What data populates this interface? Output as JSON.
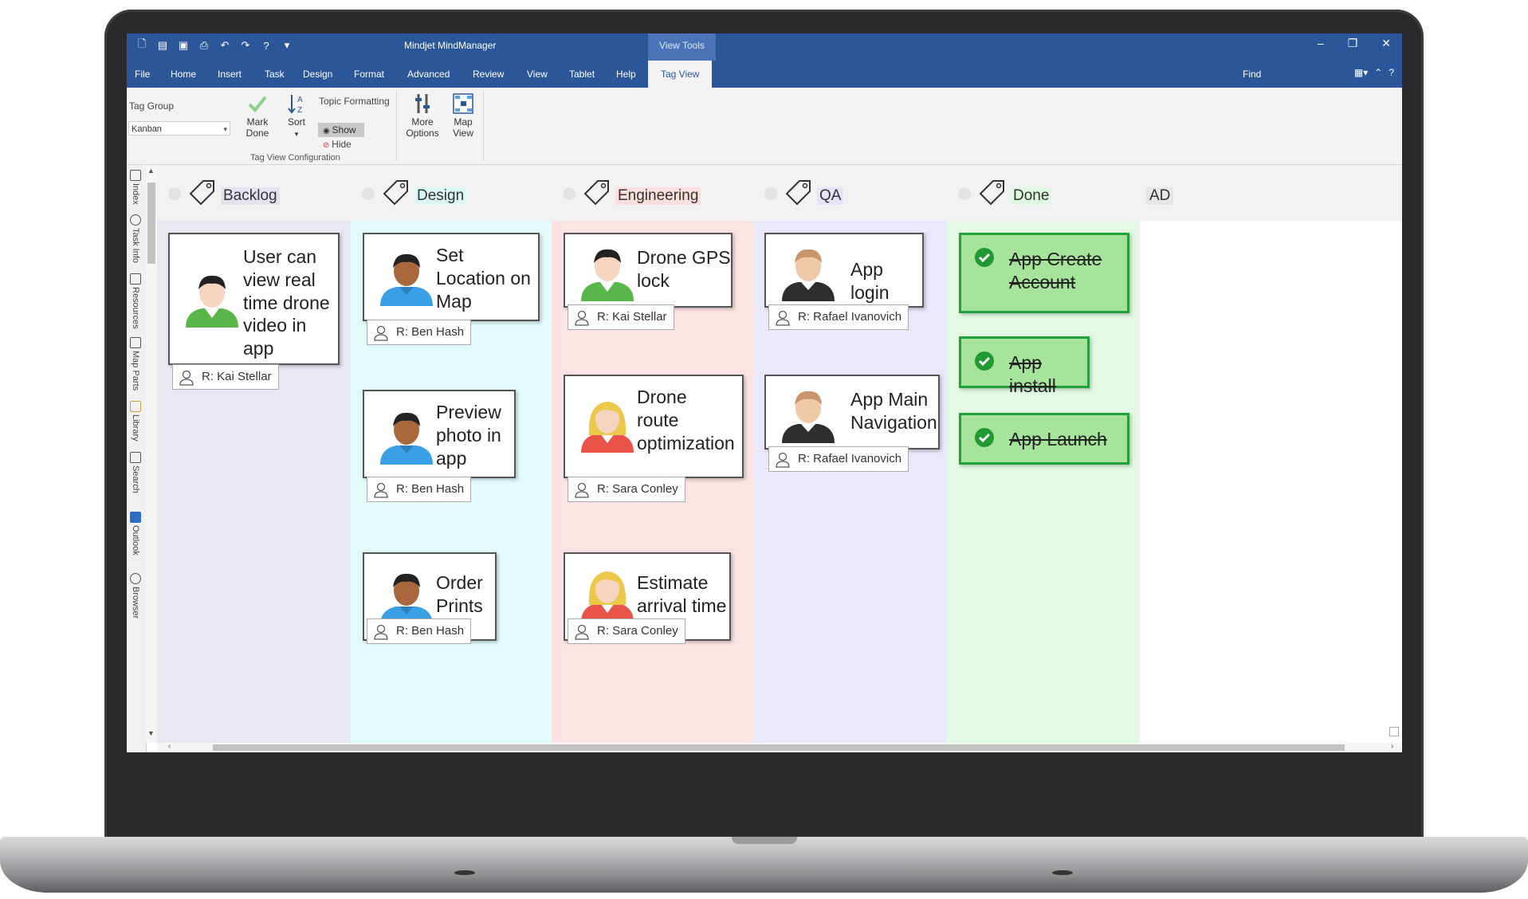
{
  "app": {
    "title": "Mindjet MindManager",
    "contextual_tab_group": "View Tools",
    "window_controls": [
      "–",
      "❐",
      "✕"
    ]
  },
  "tabs": [
    "File",
    "Home",
    "Insert",
    "Task",
    "Design",
    "Format",
    "Advanced",
    "Review",
    "View",
    "Tablet",
    "Help",
    "Tag View"
  ],
  "active_tab": "Tag View",
  "find_label": "Find",
  "ribbon": {
    "tag_group_label": "Tag Group",
    "tag_group_value": "Kanban",
    "mark_done_line1": "Mark",
    "mark_done_line2": "Done",
    "sort_label": "Sort",
    "topic_formatting_label": "Topic Formatting",
    "show_label": "Show",
    "hide_label": "Hide",
    "more_options_line1": "More",
    "more_options_line2": "Options",
    "map_view_line1": "Map",
    "map_view_line2": "View",
    "group_caption": "Tag View Configuration"
  },
  "side_tabs": [
    "Index",
    "Task Info",
    "Resources",
    "Map Parts",
    "Library",
    "Search",
    "Outlook",
    "Browser"
  ],
  "columns": [
    {
      "name": "Backlog",
      "header_bg": "#e3e3ef",
      "bg": "#e8e8f3"
    },
    {
      "name": "Design",
      "header_bg": "#ddf7f7",
      "bg": "#e2fbfb"
    },
    {
      "name": "Engineering",
      "header_bg": "#fbdede",
      "bg": "#fde3e3"
    },
    {
      "name": "QA",
      "header_bg": "#e6e4fb",
      "bg": "#e9e8fc"
    },
    {
      "name": "Done",
      "header_bg": "#e0f7e0",
      "bg": "#e3f9e3"
    },
    {
      "name": "AD",
      "header_bg": "#e6e6e6",
      "bg": "#ffffff"
    }
  ],
  "cards": {
    "backlog_1": {
      "lines": [
        "User can",
        "view real",
        "time drone",
        "video in",
        "app"
      ],
      "resource": "R: Kai Stellar"
    },
    "design_1": {
      "lines": [
        "Set",
        "Location on",
        "Map"
      ],
      "resource": "R: Ben Hash"
    },
    "design_2": {
      "lines": [
        "Preview",
        "photo in",
        "app"
      ],
      "resource": "R: Ben Hash"
    },
    "design_3": {
      "lines": [
        "Order",
        "Prints"
      ],
      "resource": "R: Ben Hash"
    },
    "eng_1": {
      "lines": [
        "Drone GPS",
        "lock"
      ],
      "resource": "R: Kai Stellar"
    },
    "eng_2": {
      "lines": [
        "Drone",
        "route",
        "optimization"
      ],
      "resource": "R: Sara Conley"
    },
    "eng_3": {
      "lines": [
        "Estimate",
        "arrival time"
      ],
      "resource": "R: Sara Conley"
    },
    "qa_1": {
      "lines": [
        "App login"
      ],
      "resource": "R: Rafael Ivanovich"
    },
    "qa_2": {
      "lines": [
        "App Main",
        "Navigation"
      ],
      "resource": "R: Rafael Ivanovich"
    },
    "done_1": {
      "lines": [
        "App Create",
        "Account"
      ]
    },
    "done_2": {
      "lines": [
        "App install"
      ]
    },
    "done_3": {
      "lines": [
        "App Launch"
      ]
    }
  }
}
